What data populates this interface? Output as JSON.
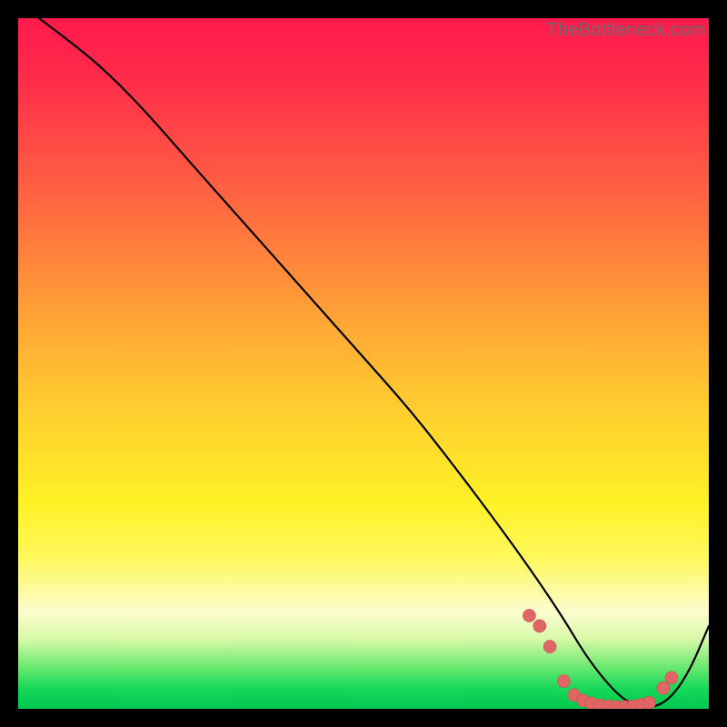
{
  "watermark": "TheBottleneck.com",
  "colors": {
    "marker": "#e06666",
    "curve": "#000000",
    "frame": "#000000"
  },
  "chart_data": {
    "type": "line",
    "title": "",
    "xlabel": "",
    "ylabel": "",
    "xlim": [
      0,
      100
    ],
    "ylim": [
      0,
      100
    ],
    "grid": false,
    "legend": false,
    "series": [
      {
        "name": "curve",
        "x": [
          3,
          7,
          12,
          18,
          25,
          33,
          41,
          49,
          57,
          64,
          70,
          75,
          79,
          82,
          85,
          88,
          91,
          94,
          97,
          100
        ],
        "y": [
          100,
          97,
          93,
          87,
          79,
          70,
          61,
          52,
          43,
          34,
          26,
          19,
          13,
          8,
          4,
          1,
          0,
          1,
          5,
          12
        ]
      }
    ],
    "markers": {
      "name": "dense-points",
      "x": [
        74,
        75.5,
        77,
        79,
        80.5,
        81.8,
        83,
        84.2,
        85.4,
        86.6,
        87.8,
        89,
        90.2,
        91.4,
        93.4,
        94.6
      ],
      "y": [
        13.5,
        12.0,
        9.0,
        4.0,
        2.0,
        1.2,
        0.8,
        0.5,
        0.4,
        0.3,
        0.3,
        0.4,
        0.6,
        0.9,
        3.0,
        4.5
      ]
    }
  }
}
